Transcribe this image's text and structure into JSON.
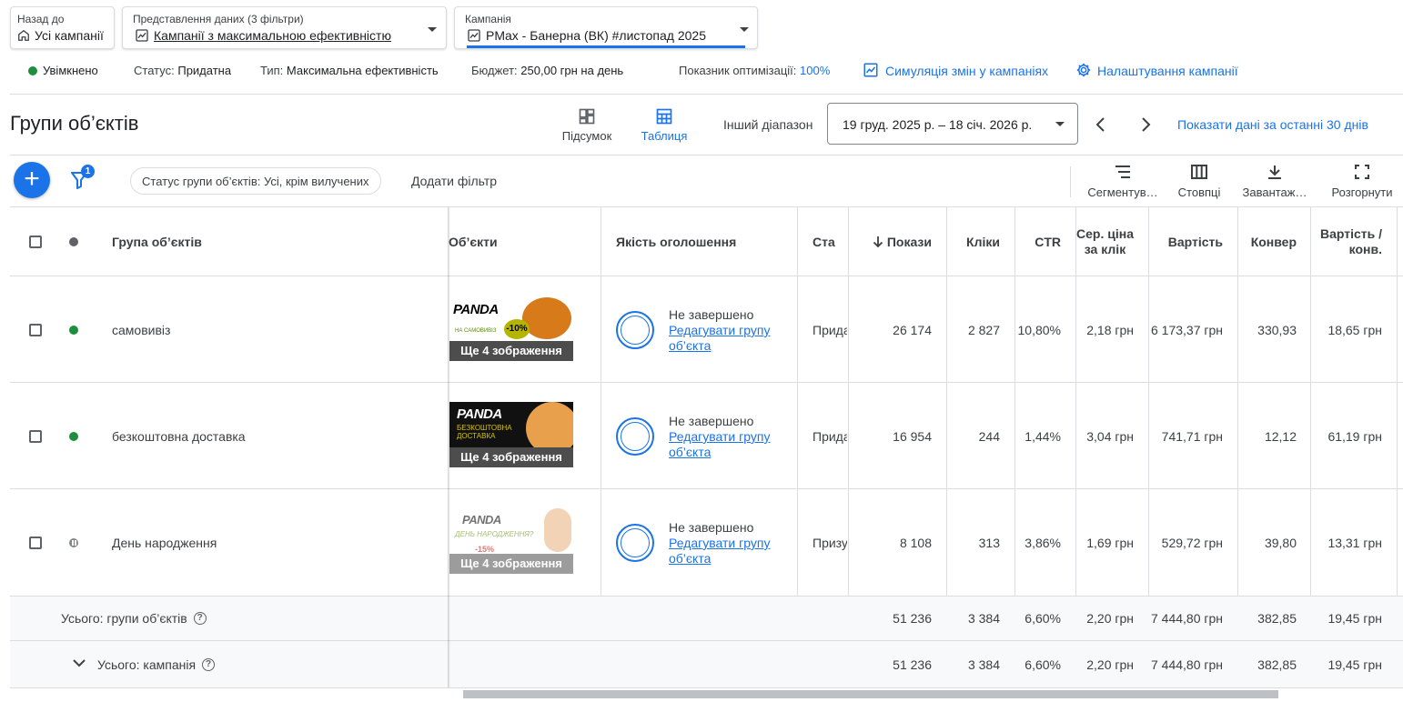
{
  "nav": {
    "back_caption": "Назад до",
    "back_value": "Усі кампанії",
    "view_caption": "Представлення даних (3 фільтри)",
    "view_value": "Кампанії з максимальною ефективністю",
    "campaign_caption": "Кампанія",
    "campaign_value": "PMax - Банерна (ВК) #листопад 2025"
  },
  "status": {
    "enabled": "Увімкнено",
    "status_label": "Статус:",
    "status_value": "Придатна",
    "type_label": "Тип:",
    "type_value": "Максимальна ефективність",
    "budget_label": "Бюджет:",
    "budget_value": "250,00 грн на день",
    "opt_label": "Показник оптимізації:",
    "opt_value": "100%",
    "simulate_link": "Симуляція змін у кампаніях",
    "settings_link": "Налаштування кампанії"
  },
  "page": {
    "title": "Групи об’єктів",
    "view_summary": "Підсумок",
    "view_table": "Таблиця",
    "range_label": "Інший діапазон",
    "date_range": "19 груд. 2025 р. – 18 січ. 2026 р.",
    "last30": "Показати дані за останні 30 днів"
  },
  "toolbar": {
    "filter_badge": "1",
    "filter_chip": "Статус групи об’єктів: Усі, крім вилучених",
    "add_filter": "Додати фільтр",
    "segment": "Сегментув…",
    "columns": "Стовпці",
    "download": "Завантаж…",
    "expand": "Розгорнути"
  },
  "table": {
    "headers": {
      "group": "Група об’єктів",
      "assets": "Об’єкти",
      "quality": "Якість оголошення",
      "status": "Ста",
      "impressions": "Покази",
      "clicks": "Кліки",
      "ctr": "CTR",
      "avg_cpc": "Сер. ціна за клік",
      "cost": "Вартість",
      "conv": "Конвер",
      "cost_per_conv": "Вартість / конв."
    },
    "rows": [
      {
        "name": "самовивіз",
        "dot": "#1e8e3e",
        "more": "Ще 4 зображення",
        "quality": "Не завершено",
        "edit": "Редагувати групу об’єкта",
        "status": "Прида",
        "impressions": "26 174",
        "clicks": "2 827",
        "ctr": "10,80%",
        "cpc": "2,18 грн",
        "cost": "6 173,37 грн",
        "conv": "330,93",
        "cpconv": "18,65 грн",
        "banner_brand": "PANDA",
        "banner_sub": "НА САМОВИВІЗ",
        "banner_badge": "-10%"
      },
      {
        "name": "безкоштовна доставка",
        "dot": "#1e8e3e",
        "more": "Ще 4 зображення",
        "quality": "Не завершено",
        "edit": "Редагувати групу об’єкта",
        "status": "Прида",
        "impressions": "16 954",
        "clicks": "244",
        "ctr": "1,44%",
        "cpc": "3,04 грн",
        "cost": "741,71 грн",
        "conv": "12,12",
        "cpconv": "61,19 грн",
        "banner_brand": "PANDA",
        "banner_sub": "БЕЗКОШТОВНА ДОСТАВКА"
      },
      {
        "name": "День народження",
        "dot": "#80868b",
        "more": "Ще 4 зображення",
        "quality": "Не завершено",
        "edit": "Редагувати групу об’єкта",
        "status": "Призу",
        "impressions": "8 108",
        "clicks": "313",
        "ctr": "3,86%",
        "cpc": "1,69 грн",
        "cost": "529,72 грн",
        "conv": "39,80",
        "cpconv": "13,31 грн",
        "banner_brand": "PANDA",
        "banner_sub": "ДЕНЬ НАРОДЖЕННЯ?",
        "banner_badge": "-15%"
      }
    ],
    "totals": [
      {
        "label": "Усього: групи об’єктів",
        "impressions": "51 236",
        "clicks": "3 384",
        "ctr": "6,60%",
        "cpc": "2,20 грн",
        "cost": "7 444,80 грн",
        "conv": "382,85",
        "cpconv": "19,45 грн"
      },
      {
        "label": "Усього: кампанія",
        "impressions": "51 236",
        "clicks": "3 384",
        "ctr": "6,60%",
        "cpc": "2,20 грн",
        "cost": "7 444,80 грн",
        "conv": "382,85",
        "cpconv": "19,45 грн"
      }
    ]
  },
  "colors": {
    "accent": "#1a73e8",
    "enabled": "#1e8e3e",
    "paused": "#80868b"
  }
}
